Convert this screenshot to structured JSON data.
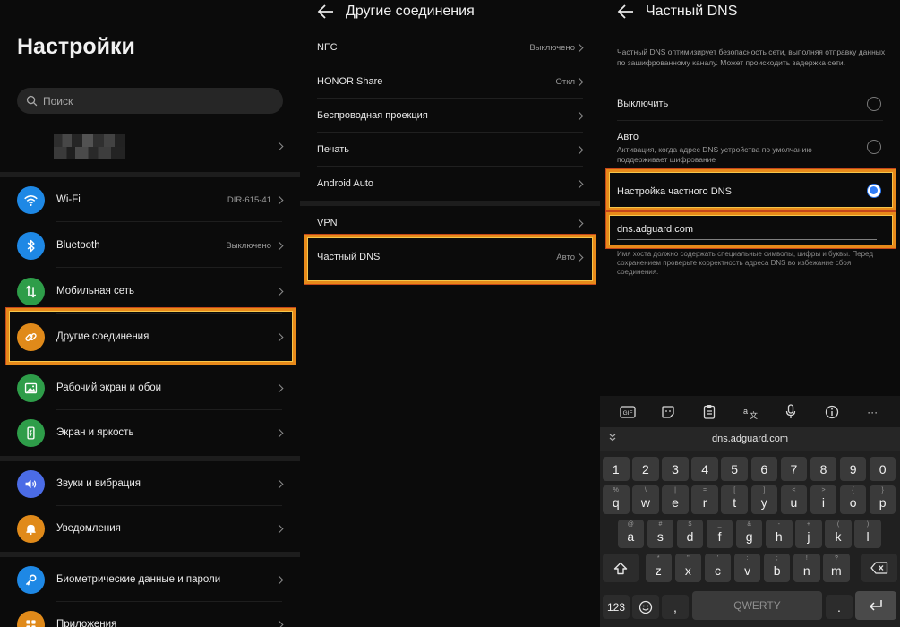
{
  "panel1": {
    "title": "Настройки",
    "search_placeholder": "Поиск",
    "items": [
      {
        "label": "Wi-Fi",
        "value": "DIR-615-41",
        "icon": "wifi-icon",
        "color": "#1e88e5"
      },
      {
        "label": "Bluetooth",
        "value": "Выключено",
        "icon": "bluetooth-icon",
        "color": "#1e88e5"
      },
      {
        "label": "Мобильная сеть",
        "value": "",
        "icon": "mobile-data-icon",
        "color": "#2e9d49"
      },
      {
        "label": "Другие соединения",
        "value": "",
        "icon": "link-icon",
        "color": "#e08a1a"
      },
      {
        "label": "Рабочий экран и обои",
        "value": "",
        "icon": "wallpaper-icon",
        "color": "#2e9d49"
      },
      {
        "label": "Экран и яркость",
        "value": "",
        "icon": "display-icon",
        "color": "#2e9d49"
      },
      {
        "label": "Звуки и вибрация",
        "value": "",
        "icon": "sound-icon",
        "color": "#4b6ce6"
      },
      {
        "label": "Уведомления",
        "value": "",
        "icon": "bell-icon",
        "color": "#e08a1a"
      },
      {
        "label": "Биометрические данные и пароли",
        "value": "",
        "icon": "key-icon",
        "color": "#1e88e5"
      },
      {
        "label": "Приложения",
        "value": "",
        "icon": "apps-icon",
        "color": "#e08a1a"
      }
    ]
  },
  "panel2": {
    "title": "Другие соединения",
    "items": [
      {
        "label": "NFC",
        "value": "Выключено"
      },
      {
        "label": "HONOR Share",
        "value": "Откл"
      },
      {
        "label": "Беспроводная проекция",
        "value": ""
      },
      {
        "label": "Печать",
        "value": ""
      },
      {
        "label": "Android Auto",
        "value": ""
      },
      {
        "label": "VPN",
        "value": ""
      },
      {
        "label": "Частный DNS",
        "value": "Авто"
      }
    ]
  },
  "panel3": {
    "title": "Частный DNS",
    "description": "Частный DNS оптимизирует безопасность сети, выполняя отправку данных по зашифрованному каналу. Может происходить задержка сети.",
    "option_off": "Выключить",
    "option_auto": "Авто",
    "option_auto_sub": "Активация, когда адрес DNS устройства по умолчанию поддерживает шифрование",
    "option_custom": "Настройка частного DNS",
    "dns_value": "dns.adguard.com",
    "hint": "Имя хоста должно содержать специальные символы, цифры и буквы. Перед сохранением проверьте корректность адреса DNS во избежание сбоя соединения.",
    "selected_option": "custom",
    "accent": "#2f7cf6"
  },
  "keyboard": {
    "toolbar": [
      "GIF",
      "sticker",
      "clipboard",
      "translate",
      "mic",
      "info",
      "···"
    ],
    "suggestion": "dns.adguard.com",
    "row_numbers": [
      "1",
      "2",
      "3",
      "4",
      "5",
      "6",
      "7",
      "8",
      "9",
      "0"
    ],
    "row1": [
      {
        "k": "q",
        "s": "%"
      },
      {
        "k": "w",
        "s": "\\"
      },
      {
        "k": "e",
        "s": "|"
      },
      {
        "k": "r",
        "s": "="
      },
      {
        "k": "t",
        "s": "["
      },
      {
        "k": "y",
        "s": "]"
      },
      {
        "k": "u",
        "s": "<"
      },
      {
        "k": "i",
        "s": ">"
      },
      {
        "k": "o",
        "s": "{"
      },
      {
        "k": "p",
        "s": "}"
      }
    ],
    "row2": [
      {
        "k": "a",
        "s": "@"
      },
      {
        "k": "s",
        "s": "#"
      },
      {
        "k": "d",
        "s": "$"
      },
      {
        "k": "f",
        "s": "_"
      },
      {
        "k": "g",
        "s": "&"
      },
      {
        "k": "h",
        "s": "-"
      },
      {
        "k": "j",
        "s": "+"
      },
      {
        "k": "k",
        "s": "("
      },
      {
        "k": "l",
        "s": ")"
      }
    ],
    "row3": [
      {
        "k": "z",
        "s": "*"
      },
      {
        "k": "x",
        "s": "\""
      },
      {
        "k": "c",
        "s": "'"
      },
      {
        "k": "v",
        "s": ":"
      },
      {
        "k": "b",
        "s": ";"
      },
      {
        "k": "n",
        "s": "!"
      },
      {
        "k": "m",
        "s": "?"
      }
    ],
    "key_123": "123",
    "key_space": "QWERTY",
    "key_period": ".",
    "key_comma": ",",
    "highlight_color": "#e88a1a"
  }
}
